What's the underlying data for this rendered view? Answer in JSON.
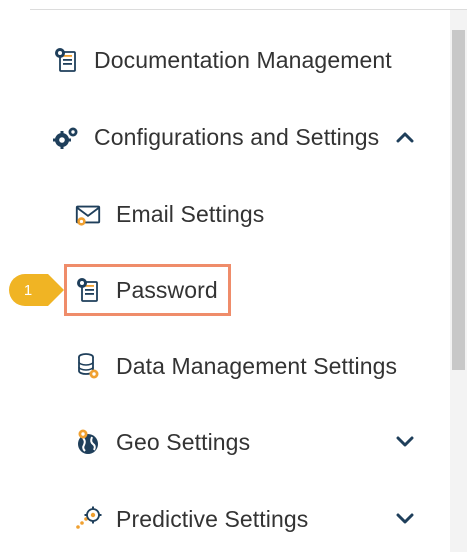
{
  "menu": {
    "items": [
      {
        "label": "Documentation Management",
        "icon": "document-gear-icon"
      },
      {
        "label": "Configurations and Settings",
        "icon": "gears-icon",
        "expanded": true
      },
      {
        "label": "Email Settings",
        "icon": "envelope-gear-icon"
      },
      {
        "label": "Password",
        "icon": "document-gear-icon",
        "highlighted": true
      },
      {
        "label": "Data Management Settings",
        "icon": "database-gear-icon"
      },
      {
        "label": "Geo Settings",
        "icon": "globe-gear-icon",
        "expanded": false
      },
      {
        "label": "Predictive Settings",
        "icon": "chart-gear-icon",
        "expanded": false
      }
    ]
  },
  "callout": {
    "number": "1",
    "color": "#f0b424"
  },
  "colors": {
    "text": "#333333",
    "icon_primary": "#1f3f5b",
    "icon_accent": "#f0a030",
    "highlight_border": "#ef8c6a",
    "chevron": "#1f3f5b"
  }
}
